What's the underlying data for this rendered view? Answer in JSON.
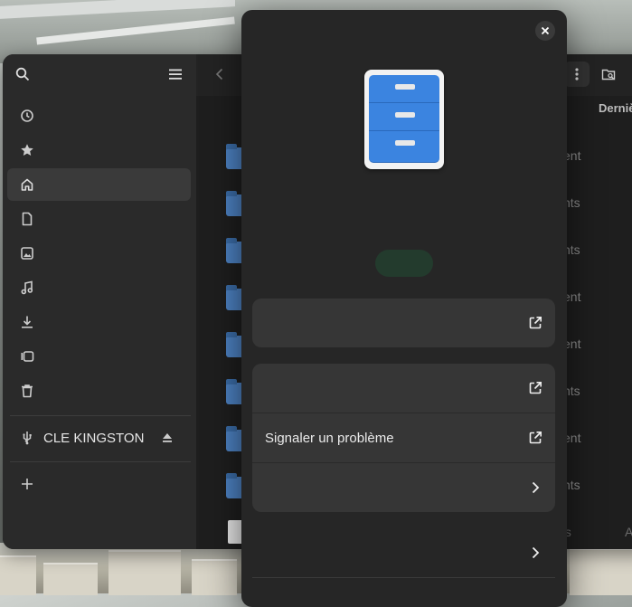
{
  "file_manager": {
    "sidebar": {
      "items": [
        {
          "icon": "recent-icon"
        },
        {
          "icon": "starred-icon"
        },
        {
          "icon": "home-icon",
          "active": true
        },
        {
          "icon": "documents-icon"
        },
        {
          "icon": "pictures-icon"
        },
        {
          "icon": "music-icon"
        },
        {
          "icon": "downloads-icon"
        },
        {
          "icon": "videos-icon"
        },
        {
          "icon": "trash-icon"
        }
      ],
      "drive": {
        "label": "CLE KINGSTON"
      }
    },
    "header": {
      "column_label": "Derniè"
    },
    "rows": [
      {
        "date": "ent"
      },
      {
        "date": "nts"
      },
      {
        "date": "nts"
      },
      {
        "date": "ent"
      },
      {
        "date": "ent"
      },
      {
        "date": "nts"
      },
      {
        "date": "ent"
      },
      {
        "date": "nts"
      },
      {
        "date": "ts",
        "extra": "A"
      }
    ]
  },
  "about_dialog": {
    "report_issue_label": "Signaler un problème",
    "accent_color": "#3b84e0"
  }
}
